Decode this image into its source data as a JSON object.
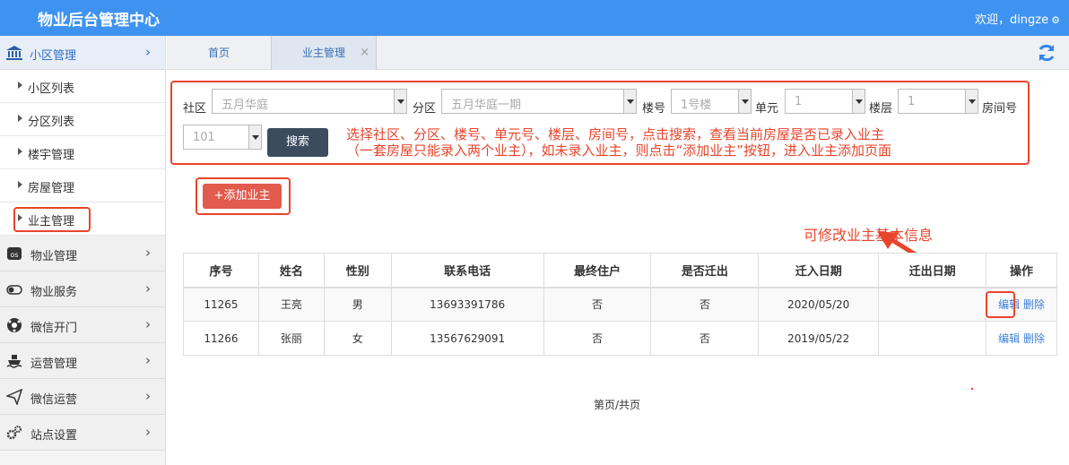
{
  "app": {
    "title": "物业后台管理中心",
    "welcome": "欢迎，dingze"
  },
  "sidebar": {
    "section": "小区管理",
    "subitems": [
      "小区列表",
      "分区列表",
      "楼宇管理",
      "房屋管理",
      "业主管理"
    ],
    "items": [
      "物业管理",
      "物业服务",
      "微信开门",
      "运营管理",
      "微信运营",
      "站点设置"
    ]
  },
  "tabs": {
    "home": "首页",
    "owner": "业主管理",
    "close": "×"
  },
  "filter": {
    "community_label": "社区",
    "community_value": "五月华庭",
    "district_label": "分区",
    "district_value": "五月华庭一期",
    "building_label": "楼号",
    "building_value": "1号楼",
    "unit_label": "单元",
    "unit_value": "1",
    "floor_label": "楼层",
    "floor_value": "1",
    "room_label": "房间号",
    "room_value": "101",
    "search_label": "搜索"
  },
  "note": {
    "line1": "选择社区、分区、楼号、单元号、楼层、房间号，点击搜索，查看当前房屋是否已录入业主",
    "line2": "（一套房屋只能录入两个业主），如未录入业主，则点击“添加业主”按钮，进入业主添加页面"
  },
  "add_button": "+添加业主",
  "annotation": "可修改业主基本信息",
  "table": {
    "headers": [
      "序号",
      "姓名",
      "性别",
      "联系电话",
      "最终住户",
      "是否迁出",
      "迁入日期",
      "迁出日期",
      "操作"
    ],
    "rows": [
      [
        "11265",
        "王亮",
        "男",
        "13693391786",
        "否",
        "否",
        "2020/05/20",
        ""
      ],
      [
        "11266",
        "张丽",
        "女",
        "13567629091",
        "否",
        "否",
        "2019/05/22",
        ""
      ]
    ],
    "edit": "编辑",
    "delete": "删除"
  },
  "pager": "第页/共页",
  "colors": {
    "topbar": "#3f93f0",
    "accent_red": "#e8452c",
    "search_btn": "#3c4b5e",
    "add_btn": "#e25b4c"
  }
}
